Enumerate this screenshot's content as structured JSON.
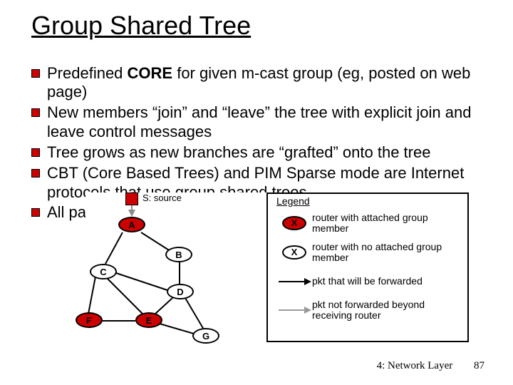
{
  "title": "Group Shared Tree",
  "bullets": [
    {
      "prefix": "Predefined ",
      "core": "CORE",
      "suffix": " for given m-cast group (eg, posted on web page)"
    },
    {
      "prefix": "",
      "core": "",
      "suffix": "New members “join” and “leave” the tree with explicit join and leave control messages"
    },
    {
      "prefix": "",
      "core": "",
      "suffix": "Tree grows as new branches are “grafted” onto the tree"
    },
    {
      "prefix": "",
      "core": "",
      "suffix": "CBT (Core Based Trees) and PIM Sparse mode are Internet protocols that use group shared trees"
    },
    {
      "prefix": "",
      "core": "",
      "suffix": "All packets sent via core"
    }
  ],
  "diagram": {
    "source_label": "S: source",
    "nodes": {
      "A": "A",
      "B": "B",
      "C": "C",
      "D": "D",
      "E": "E",
      "F": "F",
      "G": "G"
    },
    "legend": {
      "title": "Legend",
      "attached": {
        "icon": "X",
        "text": "router with attached group member"
      },
      "no_attached": {
        "icon": "X",
        "text": "router with no attached group member"
      },
      "fwd": "pkt that will be forwarded",
      "nofwd": "pkt not forwarded beyond receiving router"
    }
  },
  "footer": {
    "section": "4: Network Layer",
    "page": "87"
  }
}
